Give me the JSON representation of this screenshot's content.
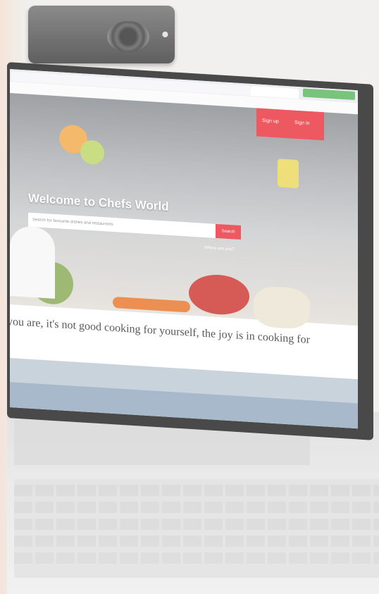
{
  "site": {
    "nav": {
      "signup_label": "Sign up",
      "signin_label": "Sign in"
    },
    "hero": {
      "headline": "Welcome to Chefs World",
      "search_placeholder": "Search for favourite dishes and restaurants",
      "search_button": "Search",
      "where_link": "Where are you?"
    },
    "quote": "you are, it's not good cooking for yourself, the joy is in cooking for"
  },
  "colors": {
    "accent": "#e8222c"
  }
}
